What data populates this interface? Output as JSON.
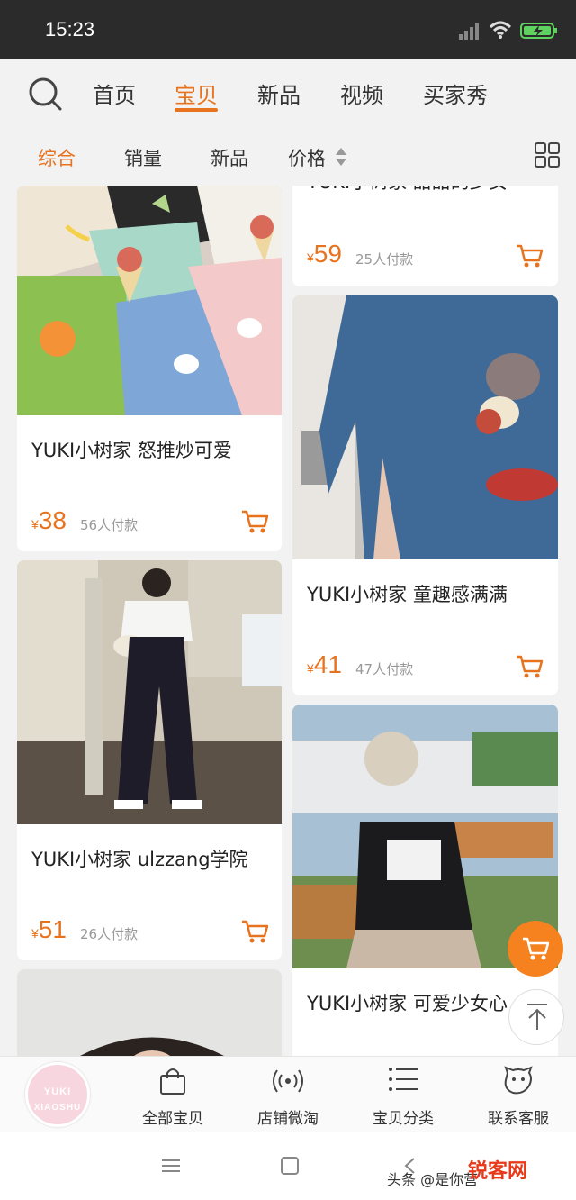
{
  "status_bar": {
    "time": "15:23"
  },
  "top_nav": {
    "tabs": [
      {
        "label": "首页",
        "active": false
      },
      {
        "label": "宝贝",
        "active": true
      },
      {
        "label": "新品",
        "active": false
      },
      {
        "label": "视频",
        "active": false
      },
      {
        "label": "买家秀",
        "active": false
      }
    ]
  },
  "sort_bar": {
    "options": [
      {
        "label": "综合",
        "active": true
      },
      {
        "label": "销量",
        "active": false
      },
      {
        "label": "新品",
        "active": false
      },
      {
        "label": "价格",
        "active": false
      }
    ]
  },
  "products": {
    "left": [
      {
        "title": "YUKI小树家 怒推炒可爱",
        "currency": "¥",
        "price": "38",
        "paid": "56人付款"
      },
      {
        "title": "YUKI小树家 ulzzang学院",
        "currency": "¥",
        "price": "51",
        "paid": "26人付款"
      }
    ],
    "right": [
      {
        "title": "YUKI小树家 甜甜的少女",
        "currency": "¥",
        "price": "59",
        "paid": "25人付款"
      },
      {
        "title": "YUKI小树家 童趣感满满",
        "currency": "¥",
        "price": "41",
        "paid": "47人付款"
      },
      {
        "title": "YUKI小树家 可爱少女心"
      }
    ]
  },
  "bottom_bar": {
    "logo_line1": "YUKI",
    "logo_line2": "XIAOSHU",
    "items": [
      {
        "label": "全部宝贝",
        "icon": "bag-icon"
      },
      {
        "label": "店铺微淘",
        "icon": "broadcast-icon"
      },
      {
        "label": "宝贝分类",
        "icon": "list-icon"
      },
      {
        "label": "联系客服",
        "icon": "chat-face-icon"
      }
    ]
  },
  "watermark": {
    "text": "头条 @是你营",
    "brand": "锐客网"
  },
  "colors": {
    "accent": "#e8731e",
    "fab": "#f5821f"
  }
}
